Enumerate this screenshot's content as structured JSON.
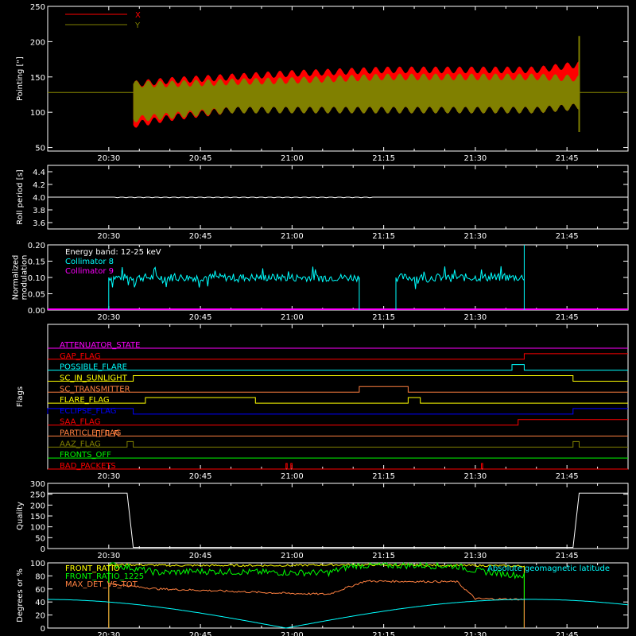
{
  "time_ticks": [
    "20:30",
    "20:45",
    "21:00",
    "21:15",
    "21:30",
    "21:45"
  ],
  "time_range": [
    "20:20",
    "21:55"
  ],
  "colors": {
    "background": "#000000",
    "axis": "#ffffff",
    "x": "#ff0000",
    "y": "#808000",
    "cyan": "#00ffff",
    "magenta": "#ff00ff",
    "yellow": "#ffff00",
    "green": "#00ff00",
    "orange": "#ff8040",
    "blue": "#0000ff",
    "red": "#ff0000"
  },
  "chart_data": [
    {
      "id": "pointing",
      "type": "area",
      "ylabel": "Pointing [\"]",
      "ylim": [
        45,
        250
      ],
      "yticks": [
        50,
        100,
        150,
        200,
        250
      ],
      "legend": {
        "placement": "top-left",
        "entries": [
          "X",
          "Y"
        ]
      },
      "reference_level": 128,
      "series": [
        {
          "name": "X",
          "color": "#ff0000",
          "t": [
            "20:34",
            "20:40",
            "20:50",
            "21:00",
            "21:15",
            "21:30",
            "21:40",
            "21:47"
          ],
          "lower": [
            82,
            92,
            103,
            103,
            103,
            103,
            103,
            108
          ],
          "upper": [
            140,
            145,
            150,
            155,
            160,
            160,
            160,
            168
          ]
        },
        {
          "name": "Y",
          "color": "#808000",
          "t": [
            "20:34",
            "20:40",
            "20:50",
            "21:00",
            "21:15",
            "21:30",
            "21:40",
            "21:47"
          ],
          "lower": [
            90,
            95,
            103,
            103,
            103,
            103,
            103,
            108
          ],
          "upper": [
            140,
            140,
            143,
            145,
            150,
            150,
            150,
            148
          ]
        }
      ],
      "spike": {
        "t": "21:47",
        "low": 72,
        "high": 208
      }
    },
    {
      "id": "roll-period",
      "type": "line",
      "ylabel": "Roll period [s]",
      "ylim": [
        3.5,
        4.5
      ],
      "yticks": [
        "3.6",
        "3.8",
        "4.0",
        "4.2",
        "4.4"
      ],
      "series": [
        {
          "name": "",
          "color": "#ffffff",
          "t": [
            "20:20",
            "21:55"
          ],
          "values": [
            4.0,
            4.0
          ]
        }
      ]
    },
    {
      "id": "modulation",
      "type": "line",
      "ylabel": [
        "Normalized",
        "modulation"
      ],
      "ylim": [
        0,
        0.2
      ],
      "yticks": [
        "0.00",
        "0.05",
        "0.10",
        "0.15",
        "0.20"
      ],
      "annotation": "Energy band: 12-25 keV",
      "series": [
        {
          "name": "Collimator 8",
          "color": "#00ffff",
          "segments": [
            [
              "20:30",
              "21:11"
            ],
            [
              "21:17",
              "21:38"
            ]
          ],
          "level": 0.1,
          "noise": 0.012,
          "edge_spike": 0.2
        },
        {
          "name": "Collimator 9",
          "color": "#ff00ff",
          "segments": [
            [
              "20:20",
              "21:55"
            ]
          ],
          "level": 0.0
        }
      ]
    },
    {
      "id": "flags",
      "type": "line",
      "ylabel": "Flags",
      "flags": [
        {
          "label": "ATTENUATOR_STATE",
          "color": "#ff00ff",
          "transitions": []
        },
        {
          "label": "GAP_FLAG",
          "color": "#ff0000",
          "transitions": [
            [
              "21:38",
              1
            ]
          ]
        },
        {
          "label": "POSSIBLE_FLARE",
          "color": "#00ffff",
          "transitions": [
            [
              "21:36",
              1
            ],
            [
              "21:38",
              0
            ]
          ]
        },
        {
          "label": "SC_IN_SUNLIGHT",
          "color": "#ffff00",
          "transitions": [
            [
              "20:34",
              1
            ],
            [
              "21:46",
              0
            ]
          ]
        },
        {
          "label": "SC_TRANSMITTER",
          "color": "#ff8040",
          "transitions": [
            [
              "21:11",
              1
            ],
            [
              "21:19",
              0
            ]
          ]
        },
        {
          "label": "FLARE_FLAG",
          "color": "#ffff00",
          "transitions": [
            [
              "20:36",
              1
            ],
            [
              "20:54",
              0
            ],
            [
              "21:19",
              1
            ],
            [
              "21:21",
              0
            ]
          ]
        },
        {
          "label": "ECLIPSE_FLAG",
          "color": "#0000ff",
          "transitions": [
            [
              "20:20",
              1
            ],
            [
              "20:34",
              0
            ],
            [
              "21:46",
              1
            ]
          ]
        },
        {
          "label": "SAA_FLAG",
          "color": "#ff0000",
          "transitions": [
            [
              "21:37",
              1
            ]
          ]
        },
        {
          "label": "PARTICLE_FLAG",
          "color": "#ff8040",
          "transitions": [
            [
              "20:28",
              1
            ],
            [
              "20:28.5",
              0
            ],
            [
              "20:29.5",
              1
            ],
            [
              "20:30",
              0
            ],
            [
              "20:31",
              1
            ],
            [
              "20:31.5",
              0
            ]
          ]
        },
        {
          "label": "AAZ_FLAG",
          "color": "#808000",
          "transitions": [
            [
              "20:33",
              1
            ],
            [
              "20:34",
              0
            ],
            [
              "21:46",
              1
            ],
            [
              "21:47",
              0
            ]
          ]
        },
        {
          "label": "FRONTS_OFF",
          "color": "#00ff00",
          "transitions": []
        },
        {
          "label": "BAD_PACKETS",
          "color": "#ff0000",
          "transitions": [
            [
              "20:59",
              1
            ],
            [
              "20:59.2",
              0
            ],
            [
              "20:59.8",
              1
            ],
            [
              "21:00",
              0
            ],
            [
              "21:31",
              1
            ],
            [
              "21:31.2",
              0
            ]
          ]
        }
      ]
    },
    {
      "id": "quality",
      "type": "line",
      "ylabel": "Quality",
      "ylim": [
        0,
        300
      ],
      "yticks": [
        "0",
        "50",
        "100",
        "150",
        "200",
        "250",
        "300"
      ],
      "series": [
        {
          "name": "",
          "color": "#ffffff",
          "t": [
            "20:20",
            "20:33",
            "20:34",
            "21:46",
            "21:47",
            "21:55"
          ],
          "values": [
            255,
            255,
            5,
            5,
            255,
            255
          ]
        }
      ]
    },
    {
      "id": "ratios",
      "type": "line",
      "ylabel": "Degrees or %",
      "ylim": [
        0,
        100
      ],
      "yticks": [
        "0",
        "20",
        "40",
        "60",
        "80",
        "100"
      ],
      "annotation": "Absolute geomagnetic latitude",
      "series": [
        {
          "name": "FRONT_RATIO",
          "color": "#ffff00",
          "t": [
            "20:30",
            "20:34",
            "20:40",
            "20:52",
            "21:00",
            "21:06",
            "21:12",
            "21:27",
            "21:30",
            "21:38"
          ],
          "values": [
            97,
            97,
            96,
            96,
            96,
            97,
            97,
            96,
            96,
            95
          ]
        },
        {
          "name": "FRONT_RATIO_1225",
          "color": "#00ff00",
          "t": [
            "20:30",
            "20:34",
            "20:38",
            "20:45",
            "21:00",
            "21:06",
            "21:10",
            "21:20",
            "21:27",
            "21:30",
            "21:38"
          ],
          "values": [
            98,
            92,
            85,
            87,
            85,
            85,
            96,
            96,
            95,
            88,
            80
          ]
        },
        {
          "name": "MAX_DET_VS_TOT",
          "color": "#ff8040",
          "t": [
            "20:30",
            "20:34",
            "20:38",
            "20:45",
            "21:00",
            "21:06",
            "21:12",
            "21:27",
            "21:30",
            "21:38"
          ],
          "values": [
            68,
            64,
            60,
            58,
            53,
            52,
            72,
            71,
            45,
            44
          ]
        },
        {
          "name": "Absolute geomagnetic latitude",
          "color": "#00ffff",
          "t": [
            "20:20",
            "20:35",
            "20:59",
            "21:19",
            "21:41",
            "21:55"
          ],
          "values": [
            20,
            42,
            0,
            43,
            0,
            30
          ]
        }
      ]
    }
  ]
}
